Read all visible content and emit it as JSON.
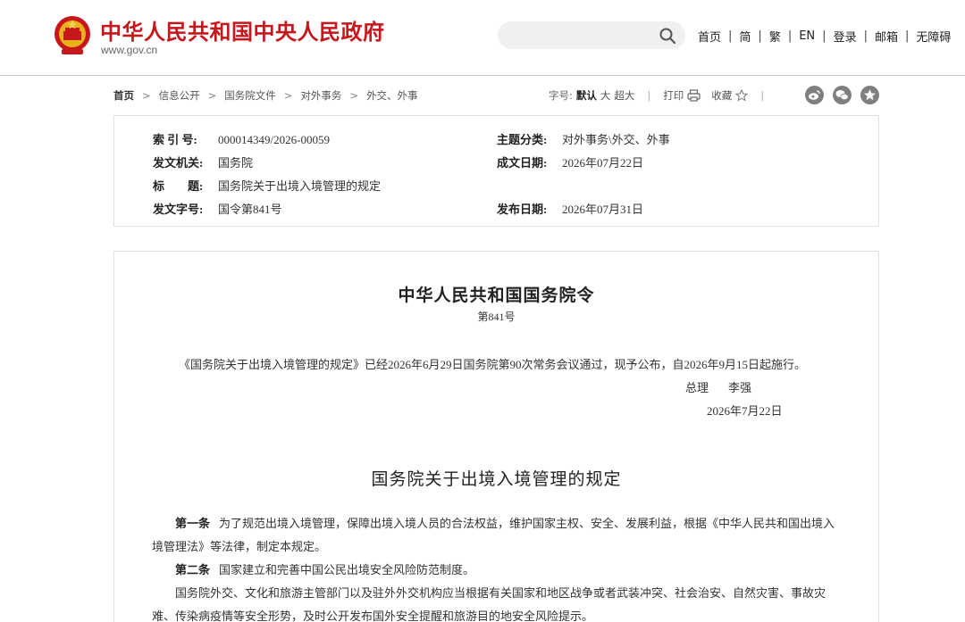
{
  "header": {
    "site_title": "中华人民共和国中央人民政府",
    "site_url": "www.gov.cn",
    "search_placeholder": "",
    "nav": [
      "首页",
      "简",
      "繁",
      "EN",
      "登录",
      "邮箱",
      "无障碍"
    ],
    "brand_color": "#c8161d"
  },
  "breadcrumb": {
    "items": [
      "首页",
      "信息公开",
      "国务院文件",
      "对外事务",
      "外交、外事"
    ],
    "font_label": "字号:",
    "font_sizes": [
      "默认",
      "大",
      "超大"
    ],
    "active_font": "默认",
    "print_label": "打印",
    "favorite_label": "收藏",
    "share_icons": [
      "weibo-icon",
      "wechat-icon",
      "qzone-icon"
    ]
  },
  "info": {
    "index_key": "索 引 号:",
    "index_val": "000014349/2026-00059",
    "topic_key": "主题分类:",
    "topic_val": "对外事务\\外交、外事",
    "issuer_key": "发文机关:",
    "issuer_val": "国务院",
    "date_key": "成文日期:",
    "date_val": "2026年07月22日",
    "title_key": "标　　题:",
    "title_val": "国务院关于出境入境管理的规定",
    "docno_key": "发文字号:",
    "docno_val": "国令第841号",
    "pub_key": "发布日期:",
    "pub_val": "2026年07月31日"
  },
  "article": {
    "order_title": "中华人民共和国国务院令",
    "order_no": "第841号",
    "announcement": "《国务院关于出境入境管理的规定》已经2026年6月29日国务院第90次常务会议通过，现予公布，自2026年9月15日起施行。",
    "signer_title": "总理",
    "signer_name": "李强",
    "sign_date": "2026年7月22日",
    "reg_title": "国务院关于出境入境管理的规定",
    "art1_label": "第一条",
    "art1_text": "为了规范出境入境管理，保障出境入境人员的合法权益，维护国家主权、安全、发展利益，根据《中华人民共和国出境入境管理法》等法律，制定本规定。",
    "art2_label": "第二条",
    "art2_text": "国家建立和完善中国公民出境安全风险防范制度。",
    "art2_para2": "国务院外交、文化和旅游主管部门以及驻外外交机构应当根据有关国家和地区战争或者武装冲突、社会治安、自然灾害、事故灾难、传染病疫情等安全形势，及时公开发布国外安全提醒和旅游目的地安全风险提示。"
  }
}
